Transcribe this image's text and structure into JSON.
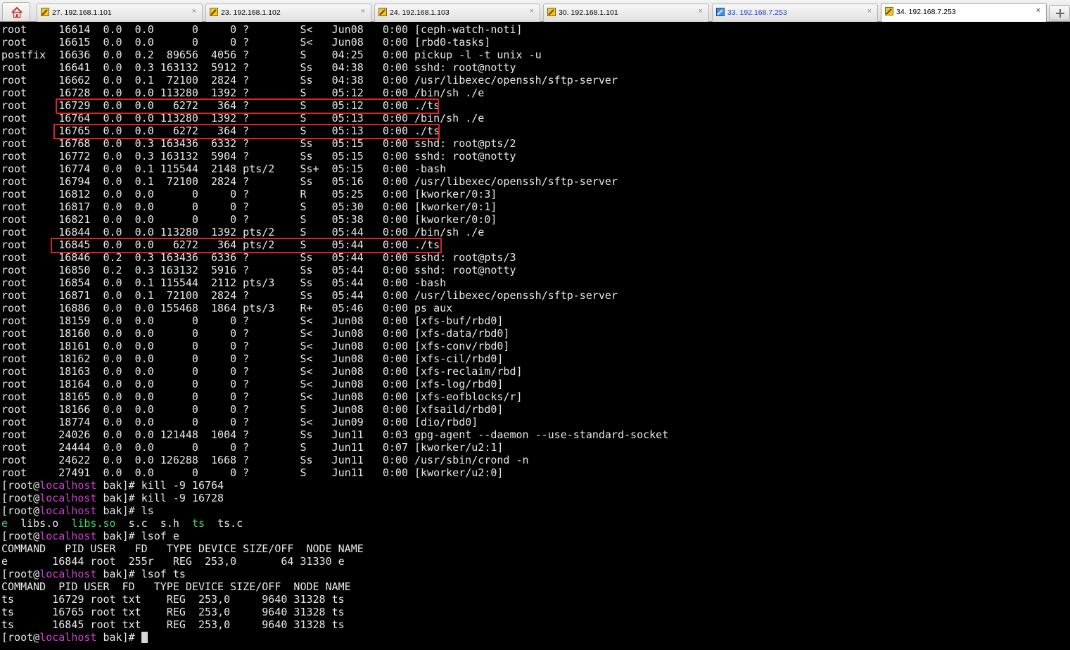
{
  "tabs": [
    {
      "label": "27. 192.168.1.101",
      "active": false
    },
    {
      "label": "23. 192.168.1.102",
      "active": false
    },
    {
      "label": "24. 192.168.1.103",
      "active": false
    },
    {
      "label": "30. 192.168.1.101",
      "active": false
    },
    {
      "label": "33. 192.168.7.253",
      "active": false
    },
    {
      "label": "34. 192.168.7.253",
      "active": true
    }
  ],
  "tab_close_glyph": "×",
  "ps_rows": [
    "root     16614  0.0  0.0      0     0 ?        S<   Jun08   0:00 [ceph-watch-noti]",
    "root     16615  0.0  0.0      0     0 ?        S<   Jun08   0:00 [rbd0-tasks]",
    "postfix  16636  0.0  0.2  89656  4056 ?        S    04:25   0:00 pickup -l -t unix -u",
    "root     16641  0.0  0.3 163132  5912 ?        Ss   04:38   0:00 sshd: root@notty",
    "root     16662  0.0  0.1  72100  2824 ?        Ss   04:38   0:00 /usr/libexec/openssh/sftp-server",
    "root     16728  0.0  0.0 113280  1392 ?        S    05:12   0:00 /bin/sh ./e",
    "root     16729  0.0  0.0   6272   364 ?        S    05:12   0:00 ./ts",
    "root     16764  0.0  0.0 113280  1392 ?        S    05:13   0:00 /bin/sh ./e",
    "root     16765  0.0  0.0   6272   364 ?        S    05:13   0:00 ./ts",
    "root     16768  0.0  0.3 163436  6332 ?        Ss   05:15   0:00 sshd: root@pts/2",
    "root     16772  0.0  0.3 163132  5904 ?        Ss   05:15   0:00 sshd: root@notty",
    "root     16774  0.0  0.1 115544  2148 pts/2    Ss+  05:15   0:00 -bash",
    "root     16794  0.0  0.1  72100  2824 ?        Ss   05:16   0:00 /usr/libexec/openssh/sftp-server",
    "root     16812  0.0  0.0      0     0 ?        R    05:25   0:00 [kworker/0:3]",
    "root     16817  0.0  0.0      0     0 ?        S    05:30   0:00 [kworker/0:1]",
    "root     16821  0.0  0.0      0     0 ?        S    05:38   0:00 [kworker/0:0]",
    "root     16844  0.0  0.0 113280  1392 pts/2    S    05:44   0:00 /bin/sh ./e",
    "root     16845  0.0  0.0   6272   364 pts/2    S    05:44   0:00 ./ts",
    "root     16846  0.2  0.3 163436  6336 ?        Ss   05:44   0:00 sshd: root@pts/3",
    "root     16850  0.2  0.3 163132  5916 ?        Ss   05:44   0:00 sshd: root@notty",
    "root     16854  0.0  0.1 115544  2112 pts/3    Ss   05:44   0:00 -bash",
    "root     16871  0.0  0.1  72100  2824 ?        Ss   05:44   0:00 /usr/libexec/openssh/sftp-server",
    "root     16886  0.0  0.0 155468  1864 pts/3    R+   05:46   0:00 ps aux",
    "root     18159  0.0  0.0      0     0 ?        S<   Jun08   0:00 [xfs-buf/rbd0]",
    "root     18160  0.0  0.0      0     0 ?        S<   Jun08   0:00 [xfs-data/rbd0]",
    "root     18161  0.0  0.0      0     0 ?        S<   Jun08   0:00 [xfs-conv/rbd0]",
    "root     18162  0.0  0.0      0     0 ?        S<   Jun08   0:00 [xfs-cil/rbd0]",
    "root     18163  0.0  0.0      0     0 ?        S<   Jun08   0:00 [xfs-reclaim/rbd]",
    "root     18164  0.0  0.0      0     0 ?        S<   Jun08   0:00 [xfs-log/rbd0]",
    "root     18165  0.0  0.0      0     0 ?        S<   Jun08   0:00 [xfs-eofblocks/r]",
    "root     18166  0.0  0.0      0     0 ?        S    Jun08   0:00 [xfsaild/rbd0]",
    "root     18774  0.0  0.0      0     0 ?        S<   Jun09   0:00 [dio/rbd0]",
    "root     24026  0.0  0.0 121448  1004 ?        Ss   Jun11   0:03 gpg-agent --daemon --use-standard-socket",
    "root     24444  0.0  0.0      0     0 ?        S    Jun11   0:07 [kworker/u2:1]",
    "root     24622  0.0  0.0 126288  1668 ?        Ss   Jun11   0:00 /usr/sbin/crond -n",
    "root     27491  0.0  0.0      0     0 ?        S    Jun11   0:00 [kworker/u2:0]"
  ],
  "prompt": {
    "open": "[",
    "user": "root",
    "at": "@",
    "host": "localhost",
    "dir": " bak]# "
  },
  "commands": [
    "kill -9 16764",
    "kill -9 16728",
    "ls",
    "lsof e",
    "lsof ts"
  ],
  "ls_output": {
    "e": "e",
    "libs_o": "libs.o",
    "libs_so": "libs.so",
    "s_c": "s.c",
    "s_h": "s.h",
    "ts": "ts",
    "ts_c": "ts.c"
  },
  "lsof_e": [
    "COMMAND   PID USER   FD   TYPE DEVICE SIZE/OFF  NODE NAME",
    "e       16844 root  255r   REG  253,0       64 31330 e"
  ],
  "lsof_ts": [
    "COMMAND  PID USER  FD   TYPE DEVICE SIZE/OFF  NODE NAME",
    "ts      16729 root txt    REG  253,0     9640 31328 ts",
    "ts      16765 root txt    REG  253,0     9640 31328 ts",
    "ts      16845 root txt    REG  253,0     9640 31328 ts"
  ]
}
